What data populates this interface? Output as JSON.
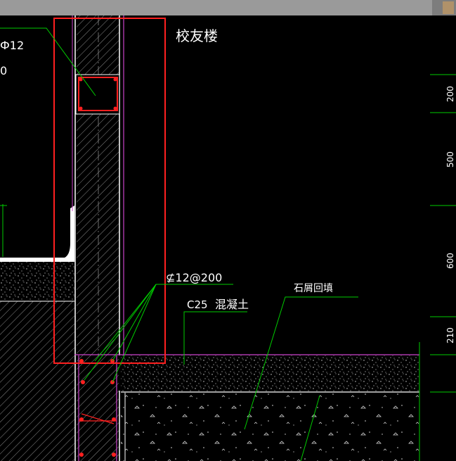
{
  "window": {
    "title_bar_color": "#9a9a9a"
  },
  "drawing": {
    "background": "#000000",
    "colors": {
      "leader": "#00cc00",
      "wall_line": "#ffffff",
      "slab_line": "#cc44cc",
      "highlight_box": "#ff2020",
      "rebar": "#ff2020"
    },
    "labels": {
      "title": "校友楼",
      "rebar_spec": "⊈12@200",
      "concrete_grade": "C25",
      "concrete_text": "混凝土",
      "fill_note": "石屑回填",
      "left_top": "Ф12",
      "left_second": "0"
    },
    "dimensions": [
      "200",
      "500",
      "600",
      "210"
    ]
  }
}
